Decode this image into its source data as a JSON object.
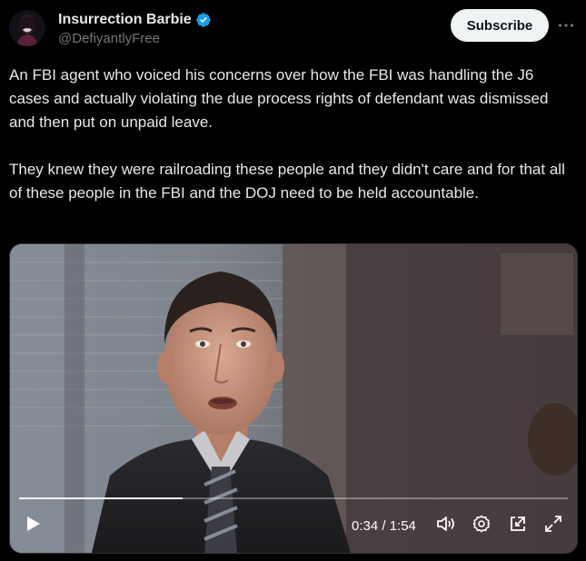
{
  "header": {
    "display_name": "Insurrection Barbie",
    "handle": "@DefiyantlyFree",
    "verified": true,
    "subscribe_label": "Subscribe",
    "more_icon": "ellipsis-icon"
  },
  "tweet": {
    "paragraphs": [
      "An FBI agent who voiced his concerns over how the FBI was handling the J6 cases and actually violating the due process rights of defendant was dismissed and then put on unpaid leave.",
      "They knew they were railroading these people and they didn't care and for that all of these people in the FBI and the DOJ need to be held accountable."
    ]
  },
  "video": {
    "current_time": "0:34",
    "duration": "1:54",
    "time_display": "0:34 / 1:54",
    "progress_fraction": 0.298,
    "controls": [
      "play-icon",
      "volume-icon",
      "settings-gear-icon",
      "picture-in-picture-icon",
      "fullscreen-icon"
    ]
  },
  "colors": {
    "background": "#000000",
    "text": "#e7e9ea",
    "secondary_text": "#71767b",
    "verified_blue": "#1d9bf0",
    "subscribe_bg": "#eff3f4"
  }
}
